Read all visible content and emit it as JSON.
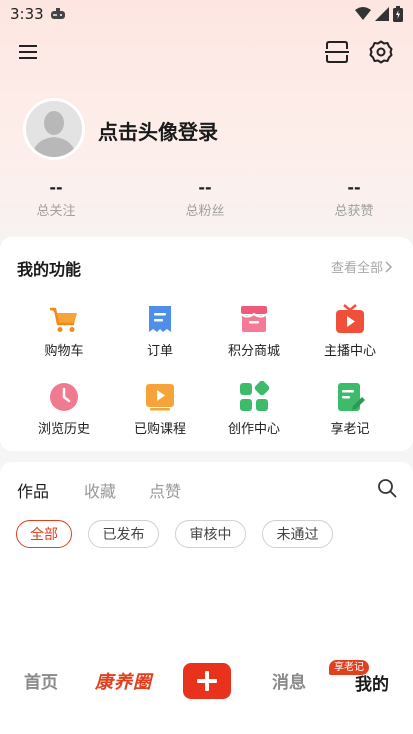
{
  "status_bar": {
    "time": "3:33"
  },
  "profile": {
    "login_prompt": "点击头像登录",
    "stats": [
      {
        "value": "--",
        "label": "总关注"
      },
      {
        "value": "--",
        "label": "总粉丝"
      },
      {
        "value": "--",
        "label": "总获赞"
      }
    ]
  },
  "functions": {
    "title": "我的功能",
    "view_all": "查看全部",
    "items": [
      {
        "label": "购物车",
        "icon": "shopping-cart-icon"
      },
      {
        "label": "订单",
        "icon": "order-icon"
      },
      {
        "label": "积分商城",
        "icon": "store-icon"
      },
      {
        "label": "主播中心",
        "icon": "tv-play-icon"
      },
      {
        "label": "浏览历史",
        "icon": "clock-icon"
      },
      {
        "label": "已购课程",
        "icon": "video-play-icon"
      },
      {
        "label": "创作中心",
        "icon": "grid-icon"
      },
      {
        "label": "享老记",
        "icon": "note-edit-icon"
      }
    ]
  },
  "works": {
    "tabs": [
      "作品",
      "收藏",
      "点赞"
    ],
    "filters": [
      "全部",
      "已发布",
      "审核中",
      "未通过"
    ]
  },
  "bottom_nav": {
    "home": "首页",
    "brand": "康养圈",
    "messages": "消息",
    "mine": "我的",
    "badge": "享老记"
  },
  "colors": {
    "accent": "#e0401e",
    "plus_button": "#e8321c",
    "header_gradient_top": "#fde6e2"
  }
}
